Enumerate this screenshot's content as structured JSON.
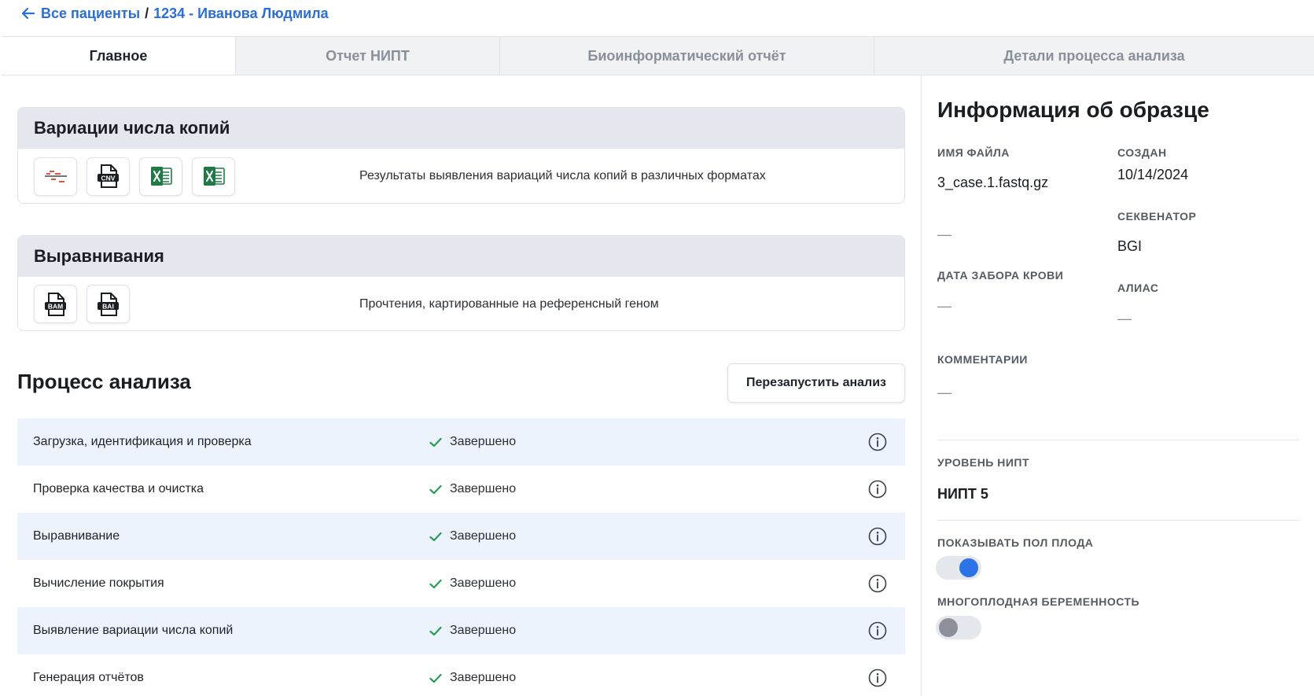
{
  "breadcrumb": {
    "back_label": "Все пациенты",
    "separator": "/",
    "current": "1234 - Иванова Людмила"
  },
  "tabs": [
    {
      "label": "Главное",
      "active": true
    },
    {
      "label": "Отчет НИПТ",
      "active": false
    },
    {
      "label": "Биоинформатический отчёт",
      "active": false
    },
    {
      "label": "Детали процесса анализа",
      "active": false
    }
  ],
  "cnv_card": {
    "title": "Вариации числа копий",
    "description": "Результаты выявления вариаций числа копий в различных форматах",
    "files": [
      {
        "icon": "cnv-plot-icon"
      },
      {
        "icon": "cnv-file-icon",
        "text": "CNV"
      },
      {
        "icon": "excel-file-icon"
      },
      {
        "icon": "excel-file-icon"
      }
    ]
  },
  "alignment_card": {
    "title": "Выравнивания",
    "description": "Прочтения, картированные на референсный геном",
    "files": [
      {
        "icon": "bam-file-icon",
        "text": "BAM"
      },
      {
        "icon": "bai-file-icon",
        "text": "BAI"
      }
    ]
  },
  "process": {
    "title": "Процесс анализа",
    "restart_label": "Перезапустить анализ",
    "steps": [
      {
        "name": "Загрузка, идентификация и проверка",
        "status": "Завершено"
      },
      {
        "name": "Проверка качества и очистка",
        "status": "Завершено"
      },
      {
        "name": "Выравнивание",
        "status": "Завершено"
      },
      {
        "name": "Вычисление покрытия",
        "status": "Завершено"
      },
      {
        "name": "Выявление вариации числа копий",
        "status": "Завершено"
      },
      {
        "name": "Генерация отчётов",
        "status": "Завершено"
      }
    ]
  },
  "sample_info": {
    "title": "Информация об образце",
    "file_name_label": "ИМЯ ФАЙЛА",
    "file_name": "3_case.1.fastq.gz",
    "created_label": "СОЗДАН",
    "created": "10/14/2024",
    "sequencer_label": "СЕКВЕНАТОР",
    "sequencer": "BGI",
    "empty_value_1": "—",
    "blood_date_label": "ДАТА ЗАБОРА КРОВИ",
    "blood_date": "—",
    "alias_label": "АЛИАС",
    "alias": "—",
    "comments_label": "КОММЕНТАРИИ",
    "comments": "—",
    "nipt_level_label": "УРОВЕНЬ НИПТ",
    "nipt_level": "НИПТ 5",
    "show_sex_label": "ПОКАЗЫВАТЬ ПОЛ ПЛОДА",
    "show_sex_on": true,
    "multiple_label": "МНОГОПЛОДНАЯ БЕРЕМЕННОСТЬ",
    "multiple_on": false
  },
  "colors": {
    "accent": "#2b6fd6",
    "success": "#2e9e5b",
    "row_alt": "#edf3fc",
    "card_header": "#e4e7ed",
    "excel": "#1f7a45"
  }
}
